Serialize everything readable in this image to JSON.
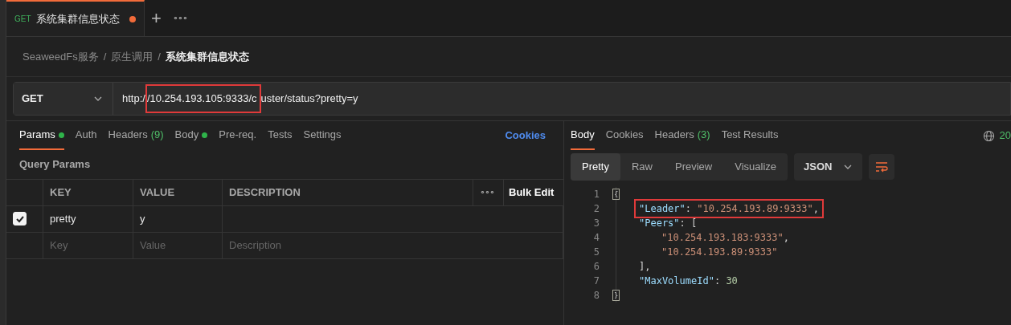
{
  "tabs": [
    {
      "method": "GET",
      "title": "系统集群信息状态",
      "unsaved": true,
      "selected": true
    }
  ],
  "tab_actions": {
    "add": "+",
    "more": "∘∘∘"
  },
  "breadcrumb": [
    {
      "text": "SeaweedFs服务"
    },
    {
      "separator": "/",
      "text": "原生调用"
    },
    {
      "separator": "/",
      "text": "系统集群信息状态"
    }
  ],
  "request": {
    "method": "GET",
    "url_parts": [
      {
        "text": "http:/",
        "highlighted": false
      },
      {
        "text": "/10.254.193.105:9333/c",
        "highlighted": true
      },
      {
        "text": "uster/status?pretty=y",
        "highlighted": false
      }
    ]
  },
  "request_tabs": [
    {
      "label": "Params",
      "dot": true,
      "selected": true
    },
    {
      "label": "Auth",
      "dot": false,
      "selected": false
    },
    {
      "label": "Headers",
      "count": "(9)",
      "dot": false,
      "selected": false
    },
    {
      "label": "Body",
      "dot": true,
      "selected": false
    },
    {
      "label": "Pre-req.",
      "dot": false,
      "selected": false
    },
    {
      "label": "Tests",
      "dot": false,
      "selected": false
    },
    {
      "label": "Settings",
      "dot": false,
      "selected": false
    }
  ],
  "cookies_link": "Cookies",
  "query_params": {
    "title": "Query Params",
    "columns": [
      "KEY",
      "VALUE",
      "DESCRIPTION"
    ],
    "more": "∘∘∘",
    "bulk_edit": "Bulk Edit",
    "rows": [
      {
        "checked": true,
        "key": "pretty",
        "value": "y"
      }
    ],
    "placeholders": {
      "key": "Key",
      "value": "Value",
      "description": "Description"
    }
  },
  "response_tabs": [
    {
      "label": "Body",
      "selected": true
    },
    {
      "label": "Cookies",
      "selected": false
    },
    {
      "label": "Headers",
      "count": "(3)",
      "selected": false
    },
    {
      "label": "Test Results",
      "selected": false
    }
  ],
  "status_code": "20",
  "view_modes": [
    {
      "label": "Pretty",
      "selected": true
    },
    {
      "label": "Raw",
      "selected": false
    },
    {
      "label": "Preview",
      "selected": false
    },
    {
      "label": "Visualize",
      "selected": false
    }
  ],
  "format": "JSON",
  "code_lines": [
    {
      "number": "1",
      "highlighted": false,
      "tokens": [
        {
          "kind": "fold",
          "text": "{"
        }
      ],
      "children": [
        {
          "number": "2",
          "highlighted": true,
          "tokens": [
            {
              "kind": "key",
              "text": "\"Leader\""
            },
            {
              "kind": "punct",
              "text": ": "
            },
            {
              "kind": "string",
              "text": "\"10.254.193.89:9333\""
            },
            {
              "kind": "punct",
              "text": ","
            }
          ]
        },
        {
          "number": "3",
          "highlighted": false,
          "tokens": [
            {
              "kind": "key",
              "text": "\"Peers\""
            },
            {
              "kind": "punct",
              "text": ": ["
            }
          ],
          "children": [
            {
              "number": "4",
              "highlighted": false,
              "tokens": [
                {
                  "kind": "string",
                  "text": "\"10.254.193.183:9333\""
                },
                {
                  "kind": "punct",
                  "text": ","
                }
              ]
            },
            {
              "number": "5",
              "highlighted": false,
              "tokens": [
                {
                  "kind": "string",
                  "text": "\"10.254.193.89:9333\""
                }
              ]
            }
          ]
        },
        {
          "number": "6",
          "highlighted": false,
          "tokens": [
            {
              "kind": "punct",
              "text": "],"
            }
          ]
        },
        {
          "number": "7",
          "highlighted": false,
          "tokens": [
            {
              "kind": "key",
              "text": "\"MaxVolumeId\""
            },
            {
              "kind": "punct",
              "text": ": "
            },
            {
              "kind": "number",
              "text": "30"
            }
          ]
        }
      ]
    },
    {
      "number": "8",
      "highlighted": false,
      "tokens": [
        {
          "kind": "fold",
          "text": "}"
        }
      ]
    }
  ]
}
